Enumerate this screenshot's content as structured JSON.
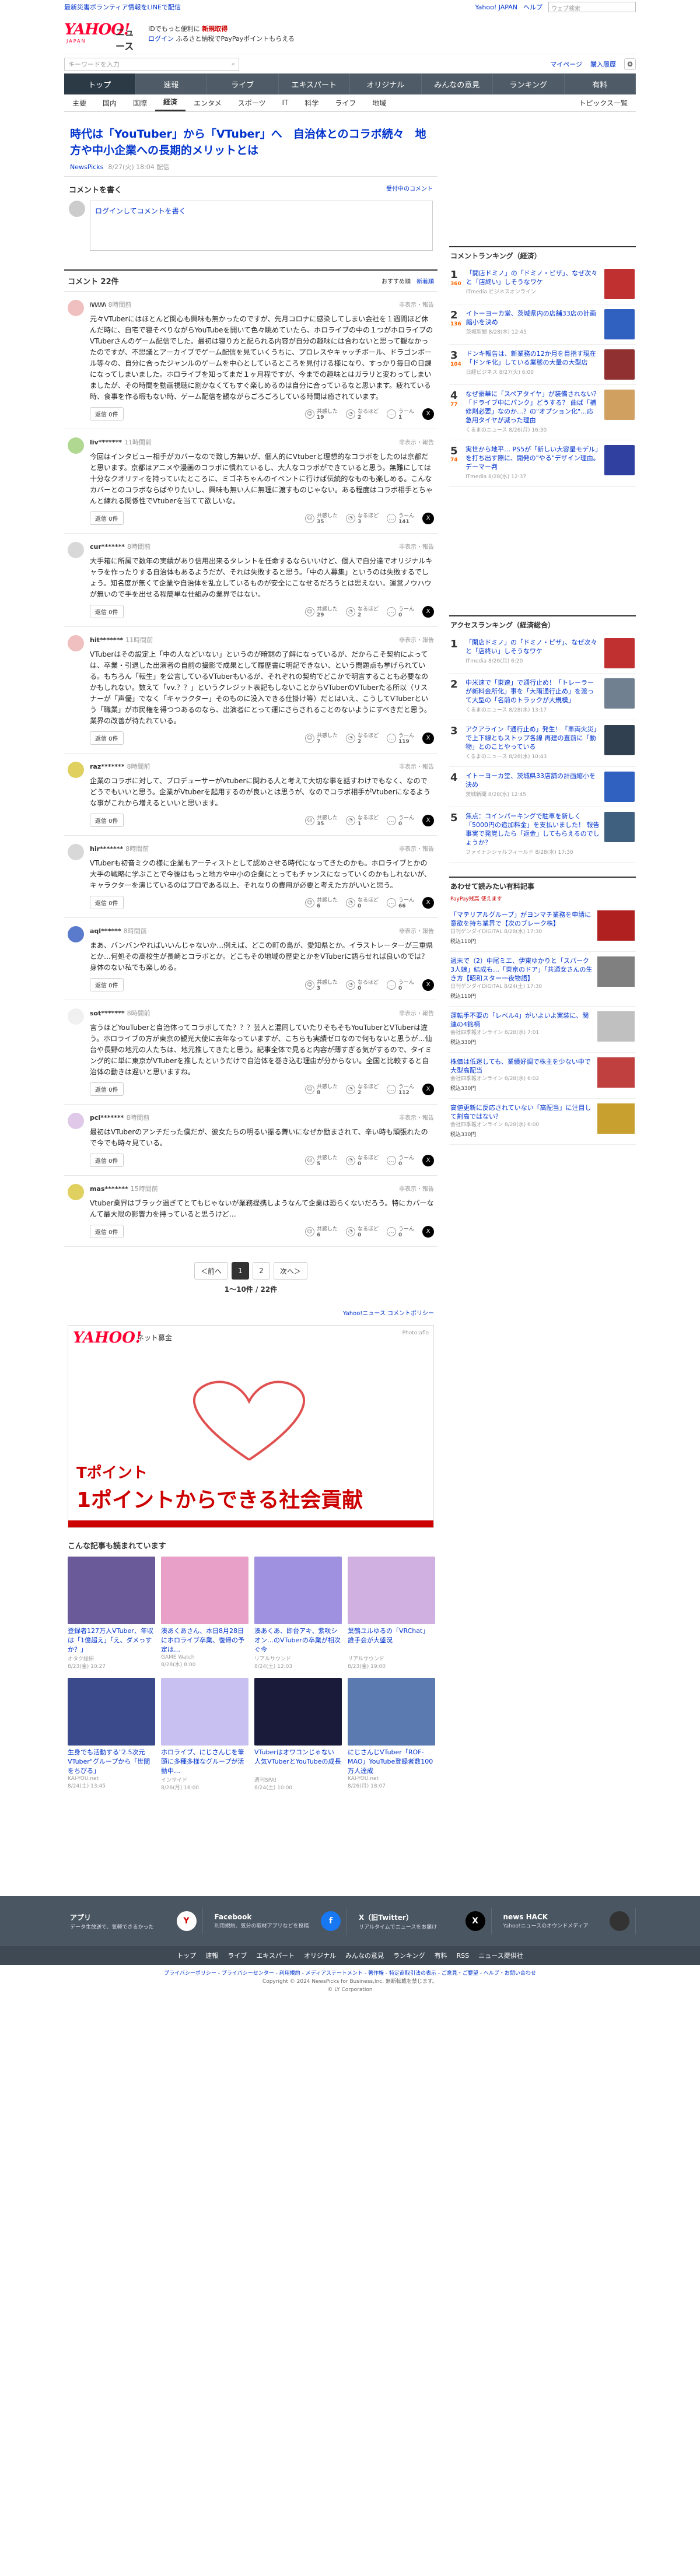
{
  "strip": {
    "left": "最新災害ボランティア情報をLINEで配信",
    "yj": "Yahoo! JAPAN",
    "help": "ヘルプ",
    "search_placeholder": "ウェブ検索"
  },
  "header": {
    "logo": "YAHOO!",
    "logo_sub": "JAPAN",
    "logo_news": "ニュース",
    "promo1": "IDでもっと便利に",
    "promo1b": "新規取得",
    "login": "ログイン",
    "promo2": "ふるさと納税でPayPayポイントもらえる"
  },
  "searchbar": {
    "placeholder": "キーワードを入力",
    "mypage": "マイページ",
    "subscribe": "購入履歴"
  },
  "nav": [
    "トップ",
    "速報",
    "ライブ",
    "エキスパート",
    "オリジナル",
    "みんなの意見",
    "ランキング",
    "有料"
  ],
  "subnav": [
    "主要",
    "国内",
    "国際",
    "経済",
    "エンタメ",
    "スポーツ",
    "IT",
    "科学",
    "ライフ",
    "地域"
  ],
  "subnav_right": "トピックス一覧",
  "article": {
    "title": "時代は「YouTuber」から「VTuber」へ　自治体とのコラボ続々　地方や中小企業への長期的メリットとは",
    "source": "NewsPicks",
    "date": "8/27(火) 18:04 配信"
  },
  "comment_write": {
    "title": "コメントを書く",
    "guide": "受付中のコメント",
    "placeholder": "ログインしてコメントを書く"
  },
  "comments_head": {
    "title": "コメント 22件",
    "sort1": "おすすめ順",
    "sort2": "新着順"
  },
  "reply_label": "返信 0件",
  "labels": {
    "kyokan": "共感した",
    "naruhodo": "なるほど",
    "uun": "うーん",
    "report": "非表示・報告"
  },
  "comments": [
    {
      "user": "ﾊﾊﾊﾊﾊ",
      "time": "8時間前",
      "text": "元々VTuberにはほとんど関心も興味も無かったのですが、先月コロナに感染してしまい会社を１週間ほど休んだ時に、自宅で寝そべりながらYouTubeを開いて色々眺めていたら、ホロライブの中の１つがホロライブのVTuberさんのゲーム配信でした。最初は寝り方と配られる内容が自分の趣味には合わないと思って観なかったのですが、不思議とアーカイブでゲーム配信を見ていくうちに、プロレスやキャッチボール、ドラゴンボール等々の、自分に合ったジャンルのゲームを中心としているところを見付ける様になり、すっかり毎日の日課になってしまいました。ホロライブを知ってまだ１ヶ月程ですが、今までの趣味とはガラリと変わってしまいましたが、その時間を動画視聴に割かなくてもすぐ楽しめるのは自分に合っているなと思います。疲れている時、食事を作る暇もない時、ゲーム配信を観ながらごろごろしている時間は癒されています。",
      "k": 19,
      "n": 2,
      "u": 1,
      "color": "#f0c0c0"
    },
    {
      "user": "liv*******",
      "time": "11時間前",
      "text": "今回はインタビュー相手がカバーなので致し方無いが、個人的にVtuberと理想的なコラボをしたのは京都だと思います。京都はアニメや漫画のコラボに慣れているし、大人なコラボができていると思う。無難にしては十分なクオリティを持っていたところに、ミゴネちゃんのイベントに行けば伝統的なものも楽しめる。こんなカバーとのコラボならばやりたいし、興味も無い人に無理に渡すものじゃない。ある程度はコラボ相手とちゃんと練れる関係性でVtuberを当てて欲しいな。",
      "k": 35,
      "n": 3,
      "u": 141,
      "color": "#b0d890"
    },
    {
      "user": "cur*******",
      "time": "8時間前",
      "text": "大手箱に所属で数年の実績があり信用出来るタレントを任命するならいいけど、個人で自分達でオリジナルキャラを作ったりする自治体もあるようだが、それは失敗すると思う。「中の人募集」というのは失敗するでしょう。知名度が無くて企業や自治体を乱立しているものが安全にこなせるだろうとは思えない。運営ノウハウが無いので手を出せる程簡単な仕組みの業界ではない。",
      "k": 29,
      "n": 2,
      "u": 0,
      "color": "#d8d8d8"
    },
    {
      "user": "hit*******",
      "time": "11時間前",
      "text": "VTuberはその設定上「中の人などいない」というのが暗黙の了解になっているが、だからこそ契約によっては、卒業・引退した出演者の自前の撮影で成果として履歴書に明記できない、という問題点も挙げられている。もちろん「転生」を公言しているVTuberもいるが、それぞれの契約でどこかで明言することも必要なのかもしれない。数えて「vv.？？」というクレジット表記もしないことからVTuberのVTuberたる所以（リスナーが「声優」でなく「キャラクター」そのものに没入できる仕掛け等）だとはいえ、こうしてVTuberという「職業」が市民権を得つつあるのなら、出演者にとって運にさらされることのないようにすべきだと思う。業界の改善が待たれている。",
      "k": 7,
      "n": 2,
      "u": 119,
      "color": "#f0c0c0"
    },
    {
      "user": "raz*******",
      "time": "8時間前",
      "text": "企業のコラボに対して、プロデューサーがVtuberに関わる人と考えて大切な事を話すわけでもなく、なのでどうでもいいと思う。企業がVtuberを起用するのが良いとは思うが、なのでコラボ相手がVtuberになるような事がこれから増えるといいと思います。",
      "k": 35,
      "n": 1,
      "u": 0,
      "color": "#e0d060"
    },
    {
      "user": "hir*******",
      "time": "8時間前",
      "text": "VTuberも初音ミクの様に企業もアーティストとして認めさせる時代になってきたのかも。ホロライブとかの大手の戦略に学ぶことで今後はもっと地方や中小の企業にとってもチャンスになっていくのかもしれないが、キャラクターを演じているのはプロである以上、それなりの費用が必要と考えた方がいいと思う。",
      "k": 6,
      "n": 0,
      "u": 66,
      "color": "#d8d8d8"
    },
    {
      "user": "aql******",
      "time": "8時間前",
      "text": "まあ、バンバンやればいいんじゃないか…例えば、どこの町の島が、愛知県とか。イラストレーターが三重県とか…何処その高校生が長崎とコラボとか。どこもその地域の歴史とかをVTuberに語らせれば良いのでは？身体のない私でも楽しめる。",
      "k": 3,
      "n": 0,
      "u": 0,
      "color": "#5a7acc"
    },
    {
      "user": "sot*******",
      "time": "8時間前",
      "text": "言うほどYouTuberと自治体ってコラボしてた？？？芸人と混同していたりそもそもYouTuberとVTuberは違う。ホロライブの方が東京の観光大使に去年なっていますが、こちらも実績ゼロなので何もないと思うが…仙台や長野の地元の人たちは、地元推してきたと思う。記事全体で見ると内容が薄すぎる気がするので、タイミング的に単に東京がVTuberを推したというだけで自治体を巻き込む理由が分からない。全国と比較すると自治体の動きは遅いと思いますね。",
      "k": 8,
      "n": 2,
      "u": 112,
      "color": "#f0f0f0"
    },
    {
      "user": "pci*******",
      "time": "8時間前",
      "text": "最初はVTuberのアンチだった僕だが、彼女たちの明るい振る舞いになぜか励まされて、辛い時も頑張れたので今でも時々見ている。",
      "k": 5,
      "n": 0,
      "u": 0,
      "color": "#e0c8e8"
    },
    {
      "user": "mas*******",
      "time": "15時間前",
      "text": "Vtuber業界はブラック過ぎてとてもじゃないが業務提携しようなんて企業は恐らくないだろう。特にカバーなんて最大限の影響力を持っていると思うけど…",
      "k": 6,
      "n": 0,
      "u": 0,
      "color": "#e0d060"
    }
  ],
  "pager": {
    "prev": "＜前へ",
    "p1": "1",
    "p2": "2",
    "next": "次へ＞",
    "count": "1〜10件 / 22件"
  },
  "policy": "Yahoo!ニュース コメントポリシー",
  "ad": {
    "logo": "YAHOO!",
    "sub": "ネット募金",
    "photo": "Photo:aflo",
    "line1": "Tポイント",
    "line2": "1ポイントからできる社会貢献"
  },
  "related": {
    "title": "こんな記事も読まれています",
    "items": [
      {
        "cap": "登録者127万人VTuber、年収は「1億超え」「え、ダメっすか？」",
        "src": "オタク総研",
        "tm": "8/23(金) 10:27",
        "c": "#6a5a9a"
      },
      {
        "cap": "湊あくあさん、本日8月28日にホロライブ卒業、復帰の予定は…",
        "src": "GAME Watch",
        "tm": "8/28(水) 8:00",
        "c": "#e8a0c8"
      },
      {
        "cap": "湊あくあ、即台アキ、紫咲シオン…のVTuberの卒業が相次ぐ今",
        "src": "リアルサウンド",
        "tm": "8/24(土) 12:03",
        "c": "#a090e0"
      },
      {
        "cap": "葉鶴ユルゆるの「VRChat」誰手会が大盛況",
        "src": "リアルサウンド",
        "tm": "8/23(金) 19:00",
        "c": "#d0b0e0"
      },
      {
        "cap": "生身でも活動する\"2.5次元VTuber\"グループから「世間をちびる」",
        "src": "KAI-YOU.net",
        "tm": "8/24(土) 13:45",
        "c": "#3a4a8a"
      },
      {
        "cap": "ホロライブ、にじさんじを筆頭に多種多様なグループが活動中…",
        "src": "インサイド",
        "tm": "8/26(月) 16:00",
        "c": "#c8c0f0"
      },
      {
        "cap": "VTuberはオワコンじゃない　人気VTuberとYouTubeの成長",
        "src": "週刊SPA!",
        "tm": "8/24(土) 10:00",
        "c": "#1a1a3a"
      },
      {
        "cap": "にじさんじVTuber「ROF-MAO」YouTube登録者数100万人達成",
        "src": "KAI-YOU.net",
        "tm": "8/26(月) 18:07",
        "c": "#5a7ab0"
      }
    ]
  },
  "side_rank": {
    "title": "コメントランキング（経済）",
    "items": [
      {
        "n": "1",
        "c": "360",
        "t": "「開店ドミノ」の「ドミノ・ピザ」、なぜ次々と「店終い」しそうなワケ",
        "s": "ITmedia ビジネスオンライン",
        "tm": "8/26(月) 6:20",
        "col": "#c03030"
      },
      {
        "n": "2",
        "c": "136",
        "t": "イトーヨーカ堂、茨城県内の店舗33店の計画縮小を決め",
        "s": "茨城新聞 8/28(水) 12:45",
        "tm": "",
        "col": "#3060c0"
      },
      {
        "n": "3",
        "c": "104",
        "t": "ドンキ報告は、新業務の12か月を目指す現在「ドンキ化」している業態の大量の大型店",
        "s": "日経ビジネス 8/27(火) 6:00",
        "tm": "",
        "col": "#903030"
      },
      {
        "n": "4",
        "c": "77",
        "t": "なぜ豪華に「スペアタイヤ」が装備されない？「ドライブ中にパンク」どうする？ 曲ば「補修剤必要」なのか…？の\"オプション化\"…応急用タイヤが減った理由",
        "s": "くるまのニュース 8/26(月) 16:30",
        "tm": "",
        "col": "#d0a060"
      },
      {
        "n": "5",
        "c": "74",
        "t": "実世から地平… PS5が「新しい大容量モデル」を打ち出す際に、開発の\"やる\"デザイン理由。デーマー判",
        "s": "ITmedia 8/28(水) 12:37",
        "tm": "",
        "col": "#3040a0"
      }
    ]
  },
  "side_rank2": {
    "title": "アクセスランキング（経済総合）",
    "items": [
      {
        "n": "1",
        "t": "「開店ドミノ」の「ドミノ・ピザ」、なぜ次々と「店終い」しそうなワケ",
        "s": "ITmedia 8/26(月) 6:20",
        "col": "#c03030"
      },
      {
        "n": "2",
        "t": "中米速で「東速」で通行止め！「トレーラーが新料金所化」事を「大雨通行止め」を渡って大型の「名前のトラックが大規模」",
        "s": "くるまのニュース 8/28(水) 13:17",
        "col": "#708090"
      },
      {
        "n": "3",
        "t": "アクアライン「通行止め」発生！「車両火災」で上下線ともストップ各線 再建の直前に「動物」とのことやっている",
        "s": "くるまのニュース 8/28(水) 10:43",
        "col": "#304050"
      },
      {
        "n": "4",
        "t": "イトーヨーカ堂、茨城県33店舗の計画縮小を決め",
        "s": "茨城新聞 8/28(水) 12:45",
        "col": "#3060c0"
      },
      {
        "n": "5",
        "t": "焦点：コインパーキングで駐車を新しく「5000円の追加料金」を支払いました！ 報告事実で発覚したら「返金」してもらえるのでしょうか？",
        "s": "ファイナンシャルフィールド 8/28(水) 17:30",
        "col": "#406080"
      }
    ]
  },
  "recommend": {
    "title": "あわせて読みたい有料記事",
    "pay": "PayPay残高 使えます",
    "items": [
      {
        "t": "「マテリアルグループ」がヨンマチ業務を申請に意欲を持ち業界で【次のブレーク株】",
        "s": "日刊ゲンダイDIGITAL 8/28(水) 17:30",
        "p": "税込110円",
        "col": "#b02020"
      },
      {
        "t": "週末で（2）中尾ミエ、伊東ゆかりと「スパーク3人娘」結成も…「東京のドア」「共通女さんの生き方【昭和スター一夜物語】",
        "s": "日刊ゲンダイDIGITAL 8/24(土) 17:30",
        "p": "税込110円",
        "col": "#808080"
      },
      {
        "t": "運転手不要の「レベル4」がいよいよ実装に、関連の4銘柄",
        "s": "会社四季報オンライン 8/28(水) 7:01",
        "p": "税込330円",
        "col": "#c0c0c0"
      },
      {
        "t": "株価は低迷しても、業績好調で株主を少ない中で大型高配当",
        "s": "会社四季報オンライン 8/28(水) 6:02",
        "p": "税込330円",
        "col": "#c04040"
      },
      {
        "t": "高値更新に反応されていない「高配当」に注目して割高ではない？",
        "s": "会社四季報オンライン 8/28(水) 6:00",
        "p": "税込330円",
        "col": "#c8a030"
      }
    ]
  },
  "footer": {
    "boxes": [
      {
        "t": "アプリ",
        "d": "データ生放送で、気軽できるかった",
        "ic": "Y"
      },
      {
        "t": "Facebook",
        "d": "利用規約、気分の取材アプリなどを投稿",
        "ic": "f"
      },
      {
        "t": "X（旧Twitter）",
        "d": "リアルタイムでニュースをお届け",
        "ic": "X"
      },
      {
        "t": "news HACK",
        "d": "Yahoo!ニュースのオウンドメディア",
        "ic": ""
      }
    ],
    "links": [
      "トップ",
      "速報",
      "ライブ",
      "エキスパート",
      "オリジナル",
      "みんなの意見",
      "ランキング",
      "有料",
      "RSS",
      "ニュース提供社"
    ],
    "legal1": "プライバシーポリシー - プライバシーセンター - 利用規約 - メディアステートメント - 著作権 - 特定商取引法の表示 - ご意見・ご要望 - ヘルプ・お問い合わせ",
    "legal2": "Copyright © 2024 NewsPicks for Business,Inc. 無断転載を禁じます。",
    "legal3": "© LY Corporation"
  }
}
